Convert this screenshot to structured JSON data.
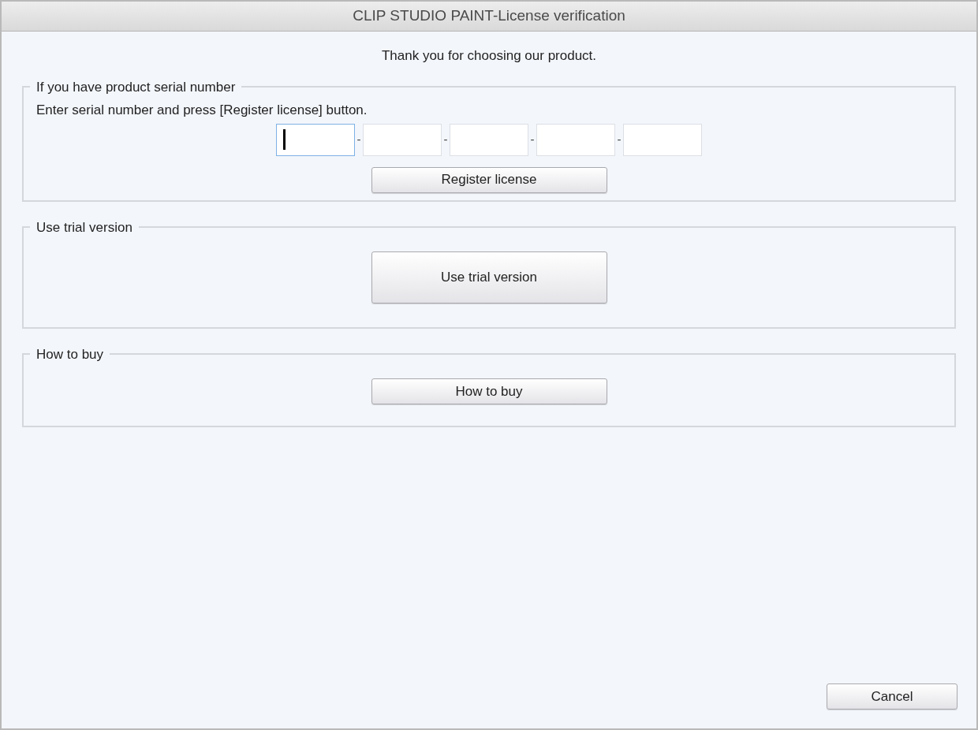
{
  "window": {
    "title": "CLIP STUDIO PAINT-License verification"
  },
  "greeting": "Thank you for choosing our product.",
  "serial_group": {
    "legend": "If you have product serial number",
    "instruction": "Enter serial number and press [Register license] button.",
    "fields": [
      {
        "focused": true
      },
      {
        "focused": false
      },
      {
        "focused": false
      },
      {
        "focused": false
      },
      {
        "focused": false
      }
    ],
    "separators": [
      "-",
      "-",
      "-",
      "-"
    ],
    "button": "Register license"
  },
  "trial_group": {
    "legend": "Use trial version",
    "button": "Use trial version"
  },
  "buy_group": {
    "legend": "How to buy",
    "button": "How to buy"
  },
  "cancel_button": "Cancel"
}
